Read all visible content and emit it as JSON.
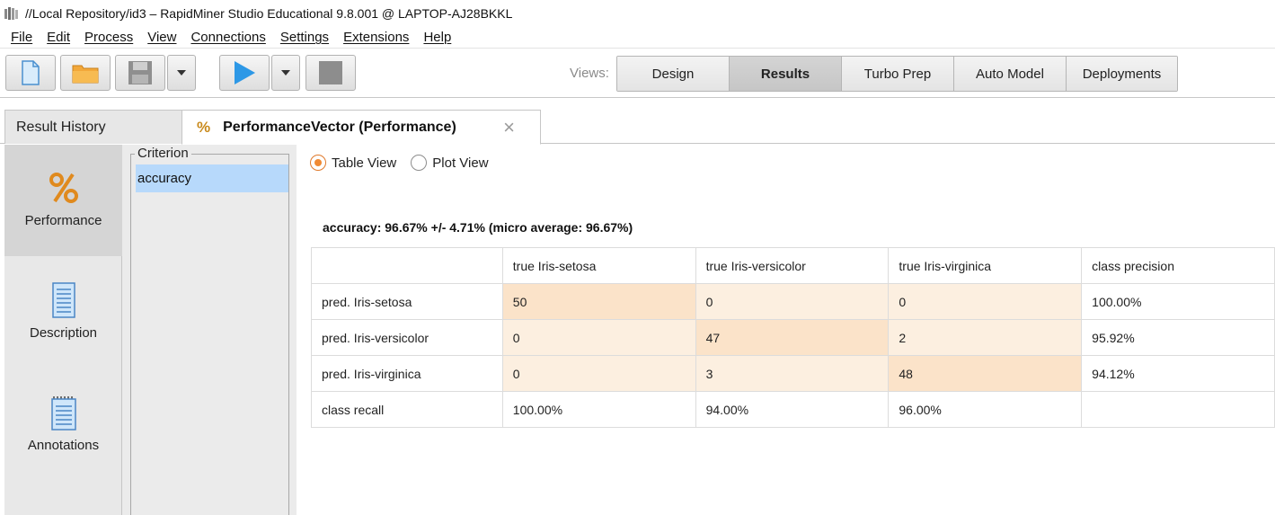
{
  "window": {
    "title": "//Local Repository/id3 – RapidMiner Studio Educational 9.8.001 @ LAPTOP-AJ28BKKL"
  },
  "menu": {
    "items": [
      "File",
      "Edit",
      "Process",
      "View",
      "Connections",
      "Settings",
      "Extensions",
      "Help"
    ]
  },
  "toolbar": {
    "icons": [
      "new-process-icon",
      "open-folder-icon",
      "save-icon",
      "dropdown-arrow-icon",
      "run-icon",
      "dropdown-arrow-icon",
      "stop-icon"
    ],
    "views_label": "Views:",
    "views": [
      "Design",
      "Results",
      "Turbo Prep",
      "Auto Model",
      "Deployments"
    ],
    "active_view": "Results"
  },
  "tabs": {
    "history": "Result History",
    "perf_icon": "%",
    "perf": "PerformanceVector (Performance)",
    "close": "×"
  },
  "sidebar": {
    "items": [
      {
        "label": "Performance",
        "icon": "percent-icon"
      },
      {
        "label": "Description",
        "icon": "document-icon"
      },
      {
        "label": "Annotations",
        "icon": "notepad-icon"
      }
    ],
    "active": "Performance"
  },
  "criterion": {
    "legend": "Criterion",
    "selected": "accuracy"
  },
  "view_options": {
    "table_view": "Table View",
    "plot_view": "Plot View",
    "selected": "Table View"
  },
  "result": {
    "accuracy_line": "accuracy: 96.67% +/- 4.71% (micro average: 96.67%)",
    "headers": [
      "",
      "true Iris-setosa",
      "true Iris-versicolor",
      "true Iris-virginica",
      "class precision"
    ],
    "rows": [
      [
        "pred. Iris-setosa",
        "50",
        "0",
        "0",
        "100.00%"
      ],
      [
        "pred. Iris-versicolor",
        "0",
        "47",
        "2",
        "95.92%"
      ],
      [
        "pred. Iris-virginica",
        "0",
        "3",
        "48",
        "94.12%"
      ],
      [
        "class recall",
        "100.00%",
        "94.00%",
        "96.00%",
        ""
      ]
    ]
  },
  "colors": {
    "diagonal_highlight": "#fbe3c9",
    "cell_highlight": "#fcefe0",
    "selection": "#b7d9fb",
    "radio_accent": "#f08a34"
  }
}
